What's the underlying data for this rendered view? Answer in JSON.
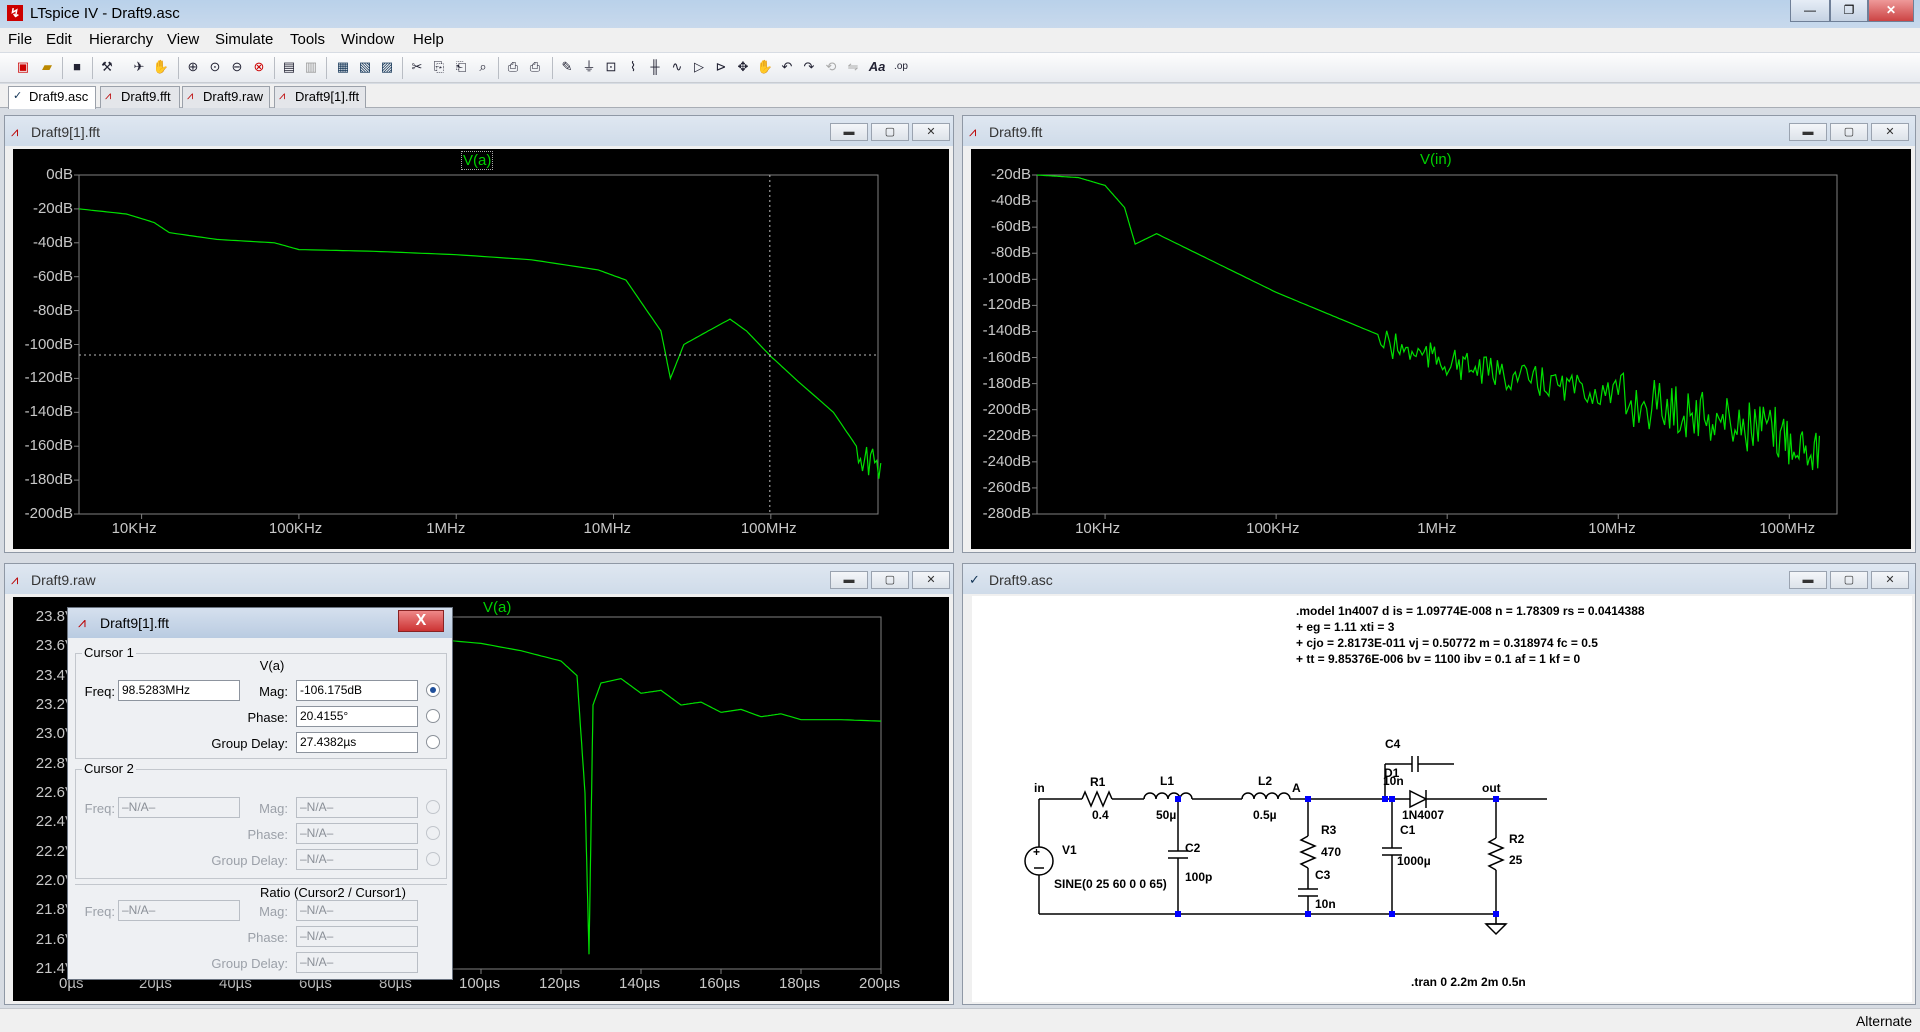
{
  "window": {
    "title": "LTspice IV - Draft9.asc"
  },
  "menu": [
    "File",
    "Edit",
    "Hierarchy",
    "View",
    "Simulate",
    "Tools",
    "Window",
    "Help"
  ],
  "tabs": [
    "Draft9.asc",
    "Draft9.fft",
    "Draft9.raw",
    "Draft9[1].fft"
  ],
  "panels": {
    "top_left": {
      "title": "Draft9[1].fft",
      "trace": "V(a)"
    },
    "top_right": {
      "title": "Draft9.fft",
      "trace": "V(in)"
    },
    "bottom_left": {
      "title": "Draft9.raw",
      "trace": "V(a)"
    },
    "bottom_right": {
      "title": "Draft9.asc"
    }
  },
  "chart_data": [
    {
      "type": "line",
      "trace": "V(a)",
      "ylim": [
        "-200dB",
        "0dB"
      ],
      "ytick_labels": [
        "0dB",
        "-20dB",
        "-40dB",
        "-60dB",
        "-80dB",
        "-100dB",
        "-120dB",
        "-140dB",
        "-160dB",
        "-180dB",
        "-200dB"
      ],
      "xtick_labels": [
        "10KHz",
        "100KHz",
        "1MHz",
        "10MHz",
        "100MHz"
      ],
      "xscale": "log",
      "x_hz": [
        4000,
        8000,
        12000,
        15000,
        30000,
        70000,
        100000,
        300000,
        1000000,
        3000000,
        8000000,
        12000000,
        20000000,
        23000000,
        28000000,
        40000000,
        55000000,
        70000000,
        100000000,
        150000000,
        250000000,
        350000000,
        500000000
      ],
      "y_db": [
        -20,
        -23,
        -28,
        -34,
        -38,
        -40,
        -44,
        -45,
        -47,
        -50,
        -56,
        -62,
        -92,
        -120,
        -100,
        -92,
        -85,
        -92,
        -107,
        -122,
        -140,
        -160,
        -170
      ],
      "cursor": {
        "freq": "98.5283MHz",
        "mag": "-106.175dB"
      }
    },
    {
      "type": "line",
      "trace": "V(in)",
      "ylim": [
        "-280dB",
        "-20dB"
      ],
      "ytick_labels": [
        "-20dB",
        "-40dB",
        "-60dB",
        "-80dB",
        "-100dB",
        "-120dB",
        "-140dB",
        "-160dB",
        "-180dB",
        "-200dB",
        "-220dB",
        "-240dB",
        "-260dB",
        "-280dB"
      ],
      "xtick_labels": [
        "10KHz",
        "100KHz",
        "1MHz",
        "10MHz",
        "100MHz"
      ],
      "xscale": "log",
      "x_hz": [
        4000,
        7000,
        10000,
        13000,
        15000,
        20000,
        100000,
        500000,
        1500000,
        5000000,
        20000000,
        60000000,
        150000000
      ],
      "y_db": [
        -20,
        -22,
        -28,
        -45,
        -73,
        -65,
        -110,
        -148,
        -165,
        -178,
        -190,
        -205,
        -220
      ]
    },
    {
      "type": "line",
      "trace": "V(a)",
      "ylim": [
        "21.4V",
        "23.8V"
      ],
      "ytick_labels": [
        "23.8V",
        "23.6V",
        "23.4V",
        "23.2V",
        "23.0V",
        "22.8V",
        "22.6V",
        "22.4V",
        "22.2V",
        "22.0V",
        "21.8V",
        "21.6V",
        "21.4V"
      ],
      "xtick_labels": [
        "0µs",
        "20µs",
        "40µs",
        "60µs",
        "80µs",
        "100µs",
        "120µs",
        "140µs",
        "160µs",
        "180µs",
        "200µs"
      ],
      "x_us": [
        0,
        40,
        80,
        100,
        110,
        120,
        124,
        126,
        127,
        128,
        130,
        135,
        140,
        145,
        150,
        155,
        160,
        165,
        170,
        175,
        180,
        190,
        200
      ],
      "y_v": [
        23.75,
        23.72,
        23.67,
        23.62,
        23.57,
        23.5,
        23.4,
        22.6,
        21.5,
        23.2,
        23.35,
        23.38,
        23.28,
        23.3,
        23.2,
        23.22,
        23.15,
        23.17,
        23.12,
        23.14,
        23.1,
        23.1,
        23.09
      ]
    }
  ],
  "cursor_dialog": {
    "title": "Draft9[1].fft",
    "close": "X",
    "cursor1_label": "Cursor 1",
    "trace": "V(a)",
    "freq_label": "Freq:",
    "freq": "98.5283MHz",
    "mag_label": "Mag:",
    "mag": "-106.175dB",
    "phase_label": "Phase:",
    "phase": "20.4155°",
    "gd_label": "Group Delay:",
    "gd": "27.4382µs",
    "cursor2_label": "Cursor 2",
    "na": "–N/A–",
    "ratio_label": "Ratio (Cursor2 / Cursor1)"
  },
  "schematic": {
    "model": [
      ".model 1n4007 d is = 1.09774E-008 n = 1.78309 rs = 0.0414388",
      "+ eg = 1.11 xti = 3",
      "+ cjo = 2.8173E-011 vj = 0.50772 m = 0.318974 fc = 0.5",
      "+ tt = 9.85376E-006 bv = 1100 ibv = 0.1 af = 1 kf = 0"
    ],
    "labels": {
      "in": "in",
      "A": "A",
      "out": "out",
      "R1": "R1",
      "R1v": "0.4",
      "L1": "L1",
      "L1v": "50µ",
      "L2": "L2",
      "L2v": "0.5µ",
      "C4": "C4",
      "C4v": "10n",
      "D1": "D1",
      "D1v": "1N4007",
      "V1": "V1",
      "V1v": "SINE(0 25 60 0 0 65)",
      "C2": "C2",
      "C2v": "100p",
      "R3": "R3",
      "R3v": "470",
      "C3": "C3",
      "C3v": "10n",
      "C1": "C1",
      "C1v": "1000µ",
      "R2": "R2",
      "R2v": "25"
    },
    "directive": ".tran 0 2.2m 2m 0.5n"
  },
  "status": "Alternate",
  "colors": {
    "trace": "#00e000",
    "bg": "#000000",
    "axis": "#808080"
  }
}
